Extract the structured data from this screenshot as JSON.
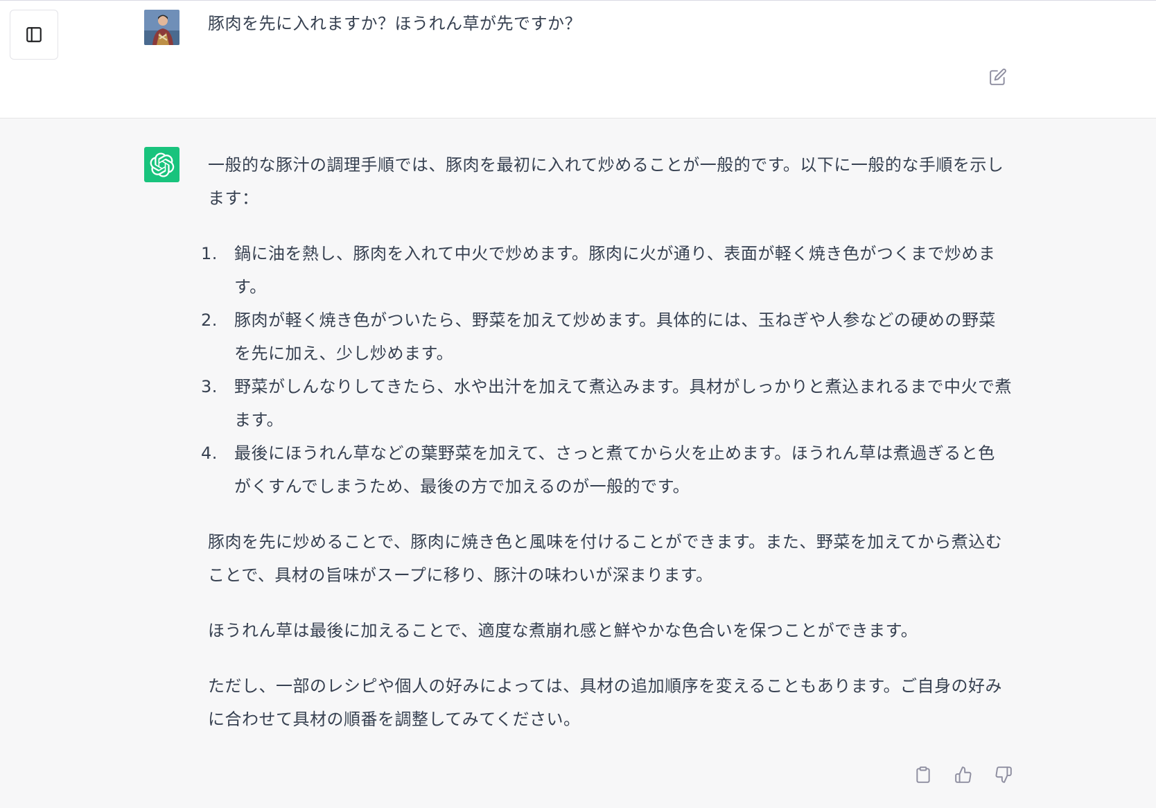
{
  "user_message": {
    "text": "豚肉を先に入れますか？ほうれん草が先ですか？"
  },
  "assistant_message": {
    "intro": "一般的な豚汁の調理手順では、豚肉を最初に入れて炒めることが一般的です。以下に一般的な手順を示します：",
    "steps": [
      {
        "num": "1.",
        "text": "鍋に油を熱し、豚肉を入れて中火で炒めます。豚肉に火が通り、表面が軽く焼き色がつくまで炒めます。"
      },
      {
        "num": "2.",
        "text": "豚肉が軽く焼き色がついたら、野菜を加えて炒めます。具体的には、玉ねぎや人参などの硬めの野菜を先に加え、少し炒めます。"
      },
      {
        "num": "3.",
        "text": "野菜がしんなりしてきたら、水や出汁を加えて煮込みます。具材がしっかりと煮込まれるまで中火で煮ます。"
      },
      {
        "num": "4.",
        "text": "最後にほうれん草などの葉野菜を加えて、さっと煮てから火を止めます。ほうれん草は煮過ぎると色がくすんでしまうため、最後の方で加えるのが一般的です。"
      }
    ],
    "paragraphs": [
      "豚肉を先に炒めることで、豚肉に焼き色と風味を付けることができます。また、野菜を加えてから煮込むことで、具材の旨味がスープに移り、豚汁の味わいが深まります。",
      "ほうれん草は最後に加えることで、適度な煮崩れ感と鮮やかな色合いを保つことができます。",
      "ただし、一部のレシピや個人の好みによっては、具材の追加順序を変えることもあります。ご自身の好みに合わせて具材の順番を調整してみてください。"
    ]
  },
  "icons": {
    "sidebar_toggle": "sidebar-toggle-icon",
    "edit": "edit-icon",
    "copy": "clipboard-icon",
    "thumbs_up": "thumbs-up-icon",
    "thumbs_down": "thumbs-down-icon",
    "assistant_logo": "openai-logo-icon"
  },
  "colors": {
    "assistant_bg": "#f7f7f8",
    "brand_green": "#19c37d",
    "text": "#374151",
    "icon_gray": "#8e8ea0"
  }
}
